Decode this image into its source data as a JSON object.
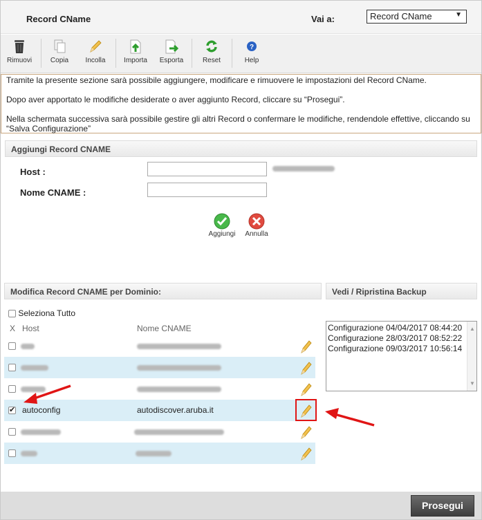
{
  "header": {
    "title": "Record CName",
    "goto_label": "Vai a:",
    "goto_selected": "Record CName"
  },
  "toolbar": [
    {
      "label": "Rimuovi",
      "icon": "trash-icon"
    },
    {
      "label": "Copia",
      "icon": "copy-icon"
    },
    {
      "label": "Incolla",
      "icon": "paste-pencil-icon"
    },
    {
      "label": "Importa",
      "icon": "import-icon"
    },
    {
      "label": "Esporta",
      "icon": "export-icon"
    },
    {
      "label": "Reset",
      "icon": "reset-icon"
    },
    {
      "label": "Help",
      "icon": "help-icon"
    }
  ],
  "info": {
    "line1": "Tramite la presente sezione sarà possibile aggiungere, modificare e rimuovere le impostazioni del Record CName.",
    "line2": "Dopo aver apportato le modifiche desiderate o aver aggiunto Record, cliccare su “Prosegui”.",
    "line3": "Nella schermata successiva sarà possibile gestire gli altri Record o confermare le modifiche, rendendole effettive, cliccando su “Salva Configurazione”"
  },
  "add_section": {
    "title": "Aggiungi Record CNAME",
    "host_label": "Host :",
    "host_value": "",
    "cname_label": "Nome CNAME :",
    "cname_value": "",
    "add_label": "Aggiungi",
    "cancel_label": "Annulla"
  },
  "records_section": {
    "title": "Modifica Record CNAME per Dominio:",
    "select_all": "Seleziona Tutto",
    "col_x": "X",
    "col_host": "Host",
    "col_cname": "Nome CNAME",
    "rows": [
      {
        "host": "",
        "cname": "",
        "checked": false
      },
      {
        "host": "",
        "cname": "",
        "checked": false
      },
      {
        "host": "",
        "cname": "",
        "checked": false
      },
      {
        "host": "autoconfig",
        "cname": "autodiscover.aruba.it",
        "checked": true
      },
      {
        "host": "",
        "cname": "",
        "checked": false
      },
      {
        "host": "",
        "cname": "",
        "checked": false
      }
    ]
  },
  "backup_section": {
    "title": "Vedi / Ripristina Backup",
    "items": [
      "Configurazione 04/04/2017 08:44:20",
      "Configurazione 28/03/2017 08:52:22",
      "Configurazione 09/03/2017 10:56:14"
    ]
  },
  "footer": {
    "proceed_label": "Prosegui"
  },
  "colors": {
    "accent_row": "#daeef7",
    "highlight": "#e01515",
    "info_border": "#c9a67d"
  }
}
